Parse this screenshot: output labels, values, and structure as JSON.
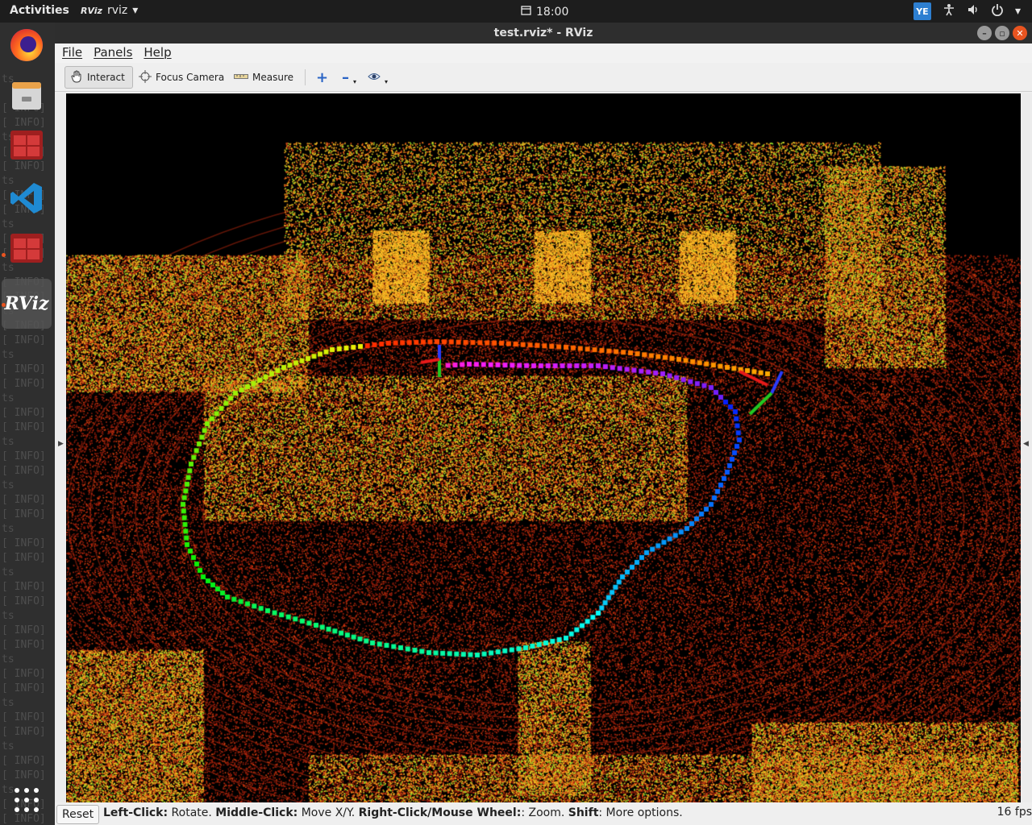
{
  "topbar": {
    "activities": "Activities",
    "app_name": "rviz",
    "app_icon": "RViz",
    "clock": "18:00",
    "ime_label": "YE",
    "icons": [
      "accessibility-icon",
      "volume-icon",
      "power-icon",
      "chevron-down-icon"
    ]
  },
  "dock": {
    "terminal_lines": [
      "",
      "ts",
      "",
      "[ INFO]",
      "[ INFO]",
      "ts",
      "[ INFO]",
      "[ INFO]",
      "ts",
      "[ INFO]",
      "[ INFO]",
      "ts",
      "[ INFO]",
      "[ INFO]",
      "ts",
      "[ INFO]",
      "[ INFO]",
      "ts",
      "[ INFO]",
      "[ INFO]",
      "ts",
      "[ INFO]",
      "[ INFO]",
      "ts",
      "[ INFO]",
      "[ INFO]",
      "ts",
      "[ INFO]",
      "[ INFO]",
      "ts",
      "[ INFO]",
      "[ INFO]",
      "ts",
      "[ INFO]",
      "[ INFO]",
      "ts",
      "[ INFO]",
      "[ INFO]",
      "ts",
      "[ INFO]",
      "[ INFO]",
      "ts",
      "[ INFO]",
      "[ INFO]",
      "ts",
      "[ INFO]",
      "[ INFO]",
      "ts",
      "[ INFO]",
      "[ INFO]",
      "ts",
      "[ INFO]",
      "[ INFO]",
      "ts"
    ],
    "rviz_label": "RViz"
  },
  "window": {
    "title": "test.rviz* - RViz",
    "menu": [
      "File",
      "Panels",
      "Help"
    ],
    "toolbar": {
      "interact": "Interact",
      "focus_camera": "Focus Camera",
      "measure": "Measure"
    }
  },
  "status": {
    "reset": "Reset",
    "hint_parts": [
      {
        "b": "Left-Click:",
        "t": " Rotate. "
      },
      {
        "b": "Middle-Click:",
        "t": " Move X/Y. "
      },
      {
        "b": "Right-Click/Mouse Wheel:",
        "t": ": Zoom. "
      },
      {
        "b": "Shift",
        "t": ": More options."
      }
    ],
    "fps": "16 fps"
  },
  "colors": {
    "ubuntu_orange": "#e95420",
    "dock_bg": "#2f2f2f",
    "viewport_bg": "#000000"
  }
}
